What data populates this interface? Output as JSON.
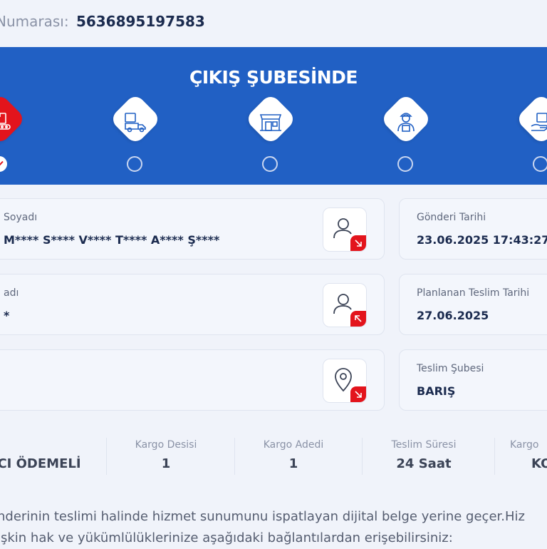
{
  "tracking": {
    "label": "Numarası:",
    "number": "5636895197583"
  },
  "status": {
    "title": "ÇIKIŞ ŞUBESİNDE",
    "steps": [
      {
        "icon": "conveyor-box-icon",
        "active": true
      },
      {
        "icon": "delivery-truck-icon",
        "active": false
      },
      {
        "icon": "branch-store-icon",
        "active": false
      },
      {
        "icon": "courier-icon",
        "active": false
      },
      {
        "icon": "hand-package-icon",
        "active": false
      }
    ]
  },
  "cards": {
    "sender": {
      "label": "Soyadı",
      "value": "M**** S**** V**** T**** A**** Ş****"
    },
    "receiver": {
      "label": "adı",
      "value": "*"
    },
    "address": {
      "label": "",
      "value": ""
    },
    "send_date": {
      "label": "Gönderi Tarihi",
      "value": "23.06.2025 17:43:27"
    },
    "planned_date": {
      "label": "Planlanan Teslim Tarihi",
      "value": "27.06.2025"
    },
    "delivery_branch": {
      "label": "Teslim Şubesi",
      "value": "BARIŞ"
    }
  },
  "summary": {
    "payment": {
      "label": "",
      "value": "CI ÖDEMELİ"
    },
    "desi": {
      "label": "Kargo Desisi",
      "value": "1"
    },
    "count": {
      "label": "Kargo Adedi",
      "value": "1"
    },
    "duration": {
      "label": "Teslim Süresi",
      "value": "24 Saat"
    },
    "type": {
      "label": "Kargo",
      "value": "KO"
    }
  },
  "footer": {
    "line1": "nderinin teslimi halinde hizmet sunumunu ispatlayan dijital belge yerine geçer.Hiz",
    "line2": "işkin hak ve yükümlülüklerinize aşağıdaki bağlantılardan erişebilirsiniz:"
  },
  "colors": {
    "banner": "#2160c4",
    "accent_red": "#e3141c",
    "background": "#f0f3fa"
  }
}
